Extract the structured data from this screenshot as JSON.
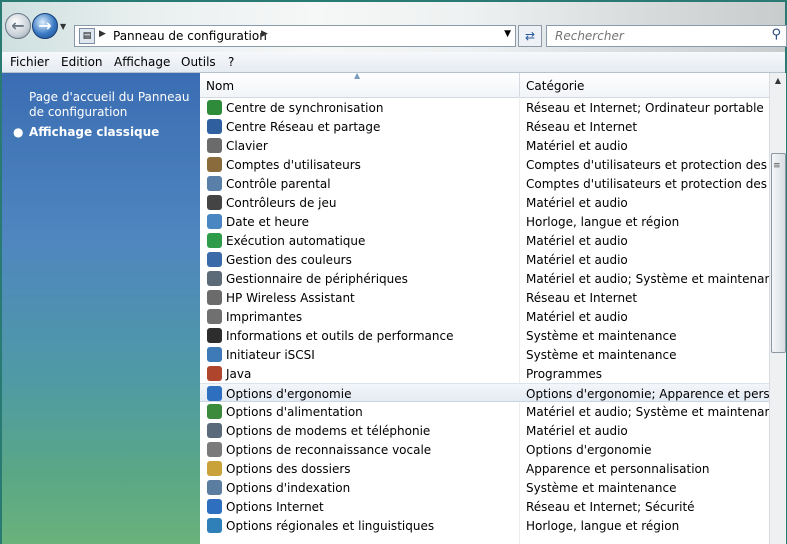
{
  "toolbar": {
    "back_icon": "back-arrow-icon",
    "forward_icon": "forward-arrow-icon",
    "address_path": "Panneau de configuration",
    "search_placeholder": "Rechercher"
  },
  "menu": [
    "Fichier",
    "Edition",
    "Affichage",
    "Outils",
    "?"
  ],
  "left_pane": {
    "home_link": "Page d'accueil du Panneau de configuration",
    "classic_view": "Affichage classique"
  },
  "columns": {
    "name": "Nom",
    "category": "Catégorie"
  },
  "items": [
    {
      "name": "Centre de synchronisation",
      "category": "Réseau et Internet; Ordinateur portable",
      "icon": "sync-icon",
      "color": "#2e8b3a"
    },
    {
      "name": "Centre Réseau et partage",
      "category": "Réseau et Internet",
      "icon": "network-icon",
      "color": "#2f5f9e"
    },
    {
      "name": "Clavier",
      "category": "Matériel et audio",
      "icon": "keyboard-icon",
      "color": "#6b6b6b"
    },
    {
      "name": "Comptes d'utilisateurs",
      "category": "Comptes d'utilisateurs et protection des utilisa",
      "icon": "users-icon",
      "color": "#8a6b3c"
    },
    {
      "name": "Contrôle parental",
      "category": "Comptes d'utilisateurs et protection des utilisa",
      "icon": "parental-icon",
      "color": "#5a7fa8"
    },
    {
      "name": "Contrôleurs de jeu",
      "category": "Matériel et audio",
      "icon": "gamepad-icon",
      "color": "#444444"
    },
    {
      "name": "Date et heure",
      "category": "Horloge, langue et région",
      "icon": "clock-icon",
      "color": "#4a86c2"
    },
    {
      "name": "Exécution automatique",
      "category": "Matériel et audio",
      "icon": "autoplay-icon",
      "color": "#2e9b4a"
    },
    {
      "name": "Gestion des couleurs",
      "category": "Matériel et audio",
      "icon": "monitor-icon",
      "color": "#3a6aa8"
    },
    {
      "name": "Gestionnaire de périphériques",
      "category": "Matériel et audio; Système et maintenance",
      "icon": "devices-icon",
      "color": "#5d6a78"
    },
    {
      "name": "HP Wireless Assistant",
      "category": "Réseau et Internet",
      "icon": "wireless-icon",
      "color": "#6b6b6b"
    },
    {
      "name": "Imprimantes",
      "category": "Matériel et audio",
      "icon": "printer-icon",
      "color": "#707070"
    },
    {
      "name": "Informations et outils de performance",
      "category": "Système et maintenance",
      "icon": "performance-icon",
      "color": "#2d2d2d"
    },
    {
      "name": "Initiateur iSCSI",
      "category": "Système et maintenance",
      "icon": "iscsi-icon",
      "color": "#3f7ab8"
    },
    {
      "name": "Java",
      "category": "Programmes",
      "icon": "java-icon",
      "color": "#b0452d"
    },
    {
      "name": "Options d'ergonomie",
      "category": "Options d'ergonomie; Apparence et personna",
      "icon": "ergonomics-icon",
      "color": "#2e6fc0"
    },
    {
      "name": "Options d'alimentation",
      "category": "Matériel et audio; Système et maintenance; Or",
      "icon": "power-icon",
      "color": "#3c8a3c"
    },
    {
      "name": "Options de modems et téléphonie",
      "category": "Matériel et audio",
      "icon": "phone-icon",
      "color": "#5a6a7a"
    },
    {
      "name": "Options de reconnaissance vocale",
      "category": "Options d'ergonomie",
      "icon": "microphone-icon",
      "color": "#7a7a7a"
    },
    {
      "name": "Options des dossiers",
      "category": "Apparence et personnalisation",
      "icon": "folder-options-icon",
      "color": "#c9a23a"
    },
    {
      "name": "Options d'indexation",
      "category": "Système et maintenance",
      "icon": "indexing-icon",
      "color": "#5b7da0"
    },
    {
      "name": "Options Internet",
      "category": "Réseau et Internet; Sécurité",
      "icon": "internet-icon",
      "color": "#2e6fc0"
    },
    {
      "name": "Options régionales et linguistiques",
      "category": "Horloge, langue et région",
      "icon": "globe-icon",
      "color": "#2f7fb8"
    }
  ],
  "selected_index": 15
}
